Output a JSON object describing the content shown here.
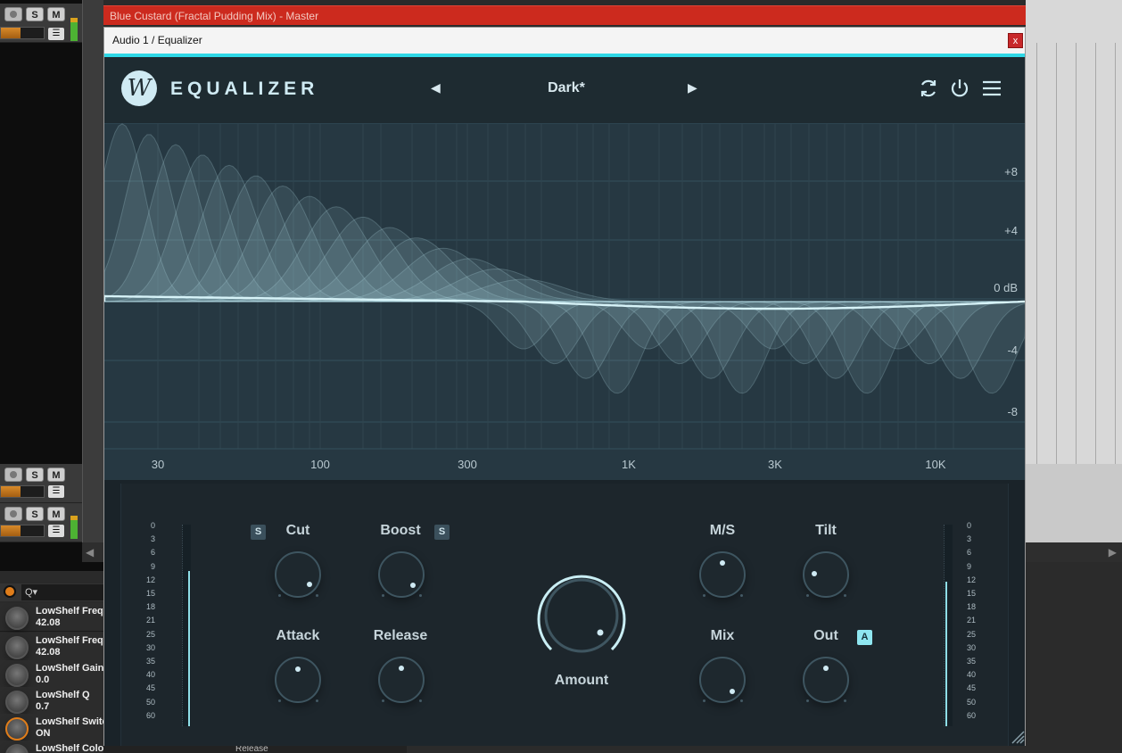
{
  "daw": {
    "master_track_title": "Blue Custard (Fractal Pudding Mix) - Master",
    "track_buttons": {
      "solo": "S",
      "mute": "M",
      "menu": "☰"
    },
    "search_icon": "Q▾",
    "scroll_left": "◀",
    "scroll_right": "▶",
    "params": [
      {
        "name": "LowShelf Frequ",
        "value": "42.08"
      },
      {
        "name": "LowShelf Frequ",
        "value": "42.08"
      },
      {
        "name": "LowShelf Gain",
        "value": "0.0"
      },
      {
        "name": "LowShelf Q",
        "value": "0.7"
      },
      {
        "name": "LowShelf Switch",
        "value": "ON"
      },
      {
        "name": "LowShelf Color",
        "value": ""
      }
    ],
    "bottom_label": "Release"
  },
  "window": {
    "title": "Audio 1 / Equalizer",
    "close_label": "x"
  },
  "plugin": {
    "logo_letter": "W",
    "brand": "EQUALIZER",
    "preset": {
      "prev": "◀",
      "name": "Dark*",
      "next": "▶"
    },
    "icons": [
      "sync-icon",
      "power-icon",
      "menu-icon"
    ],
    "accent_color": "#2fd8e6"
  },
  "graph": {
    "db_labels": [
      "+8",
      "+4",
      "0 dB",
      "-4",
      "-8"
    ],
    "freq_labels": [
      "30",
      "100",
      "300",
      "1K",
      "3K",
      "10K"
    ]
  },
  "controls": {
    "meter_ticks": [
      "0",
      "3",
      "6",
      "9",
      "12",
      "15",
      "18",
      "21",
      "25",
      "30",
      "35",
      "40",
      "45",
      "50",
      "60"
    ],
    "cut": {
      "label": "Cut",
      "solo": "S"
    },
    "boost": {
      "label": "Boost",
      "solo": "S"
    },
    "attack": {
      "label": "Attack"
    },
    "release": {
      "label": "Release"
    },
    "amount": {
      "label": "Amount"
    },
    "ms": {
      "label": "M/S"
    },
    "tilt": {
      "label": "Tilt"
    },
    "mix": {
      "label": "Mix"
    },
    "out": {
      "label": "Out",
      "auto": "A"
    }
  }
}
